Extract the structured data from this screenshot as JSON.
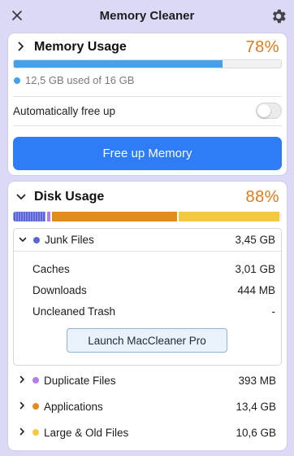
{
  "window": {
    "title": "Memory Cleaner",
    "close_icon": "close-icon",
    "settings_icon": "gear-icon"
  },
  "memory": {
    "title": "Memory Usage",
    "percent": "78%",
    "fill_fraction": 0.78,
    "used_text": "12,5 GB used of 16 GB",
    "bar_color": "#41a1ec",
    "auto_free_label": "Automatically free up",
    "auto_free_enabled": false,
    "button_label": "Free up Memory"
  },
  "disk": {
    "title": "Disk Usage",
    "percent": "88%",
    "segments": [
      {
        "name": "Junk Files",
        "color": "#5a66d6",
        "fraction": 0.12
      },
      {
        "name": "Duplicate Files",
        "color": "#b57ee3",
        "fraction": 0.02
      },
      {
        "name": "Applications",
        "color": "#e08d1e",
        "fraction": 0.47
      },
      {
        "name": "Large & Old Files",
        "color": "#f3c944",
        "fraction": 0.38
      }
    ],
    "junk": {
      "label": "Junk Files",
      "value": "3,45 GB",
      "color": "#5a66d6",
      "items": [
        {
          "label": "Caches",
          "value": "3,01 GB"
        },
        {
          "label": "Downloads",
          "value": "444 MB"
        },
        {
          "label": "Uncleaned Trash",
          "value": "-"
        }
      ],
      "launch_button": "Launch MacCleaner Pro"
    },
    "categories": [
      {
        "label": "Duplicate Files",
        "value": "393 MB",
        "color": "#b57ee3"
      },
      {
        "label": "Applications",
        "value": "13,4 GB",
        "color": "#e08d1e"
      },
      {
        "label": "Large & Old Files",
        "value": "10,6 GB",
        "color": "#f3c944"
      }
    ]
  }
}
